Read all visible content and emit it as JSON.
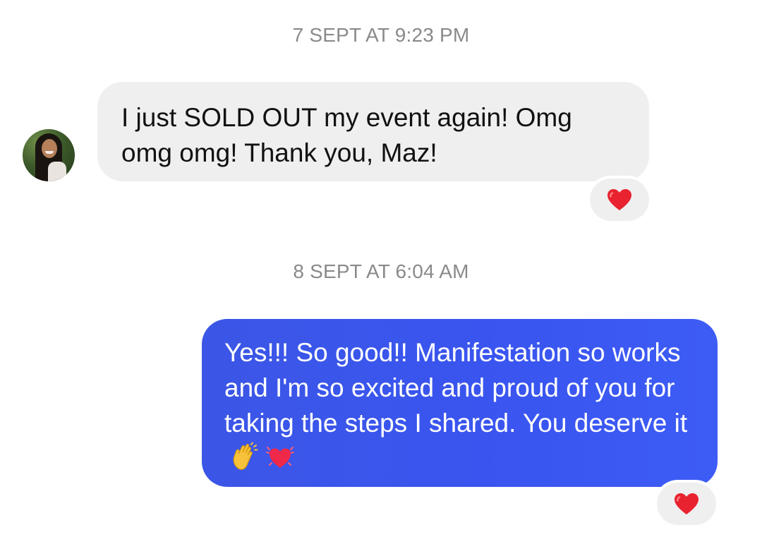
{
  "conversation": {
    "messages": [
      {
        "timestamp": "7 SEPT AT 9:23 PM",
        "direction": "incoming",
        "text": "I just SOLD OUT my event again! Omg omg omg! Thank you, Maz!",
        "reaction_icon": "red-heart-icon"
      },
      {
        "timestamp": "8 SEPT AT 6:04 AM",
        "direction": "outgoing",
        "text": "Yes!!! So good!! Manifestation so works and I'm so excited and proud of you for taking the steps I shared. You deserve it",
        "emojis": [
          "clapping-hands-icon",
          "beating-heart-icon"
        ],
        "reaction_icon": "red-heart-icon"
      }
    ]
  },
  "colors": {
    "incoming_bubble": "#efefef",
    "outgoing_bubble": "#3a55f0",
    "timestamp_text": "#8a8a8a",
    "heart": "#e8232f"
  }
}
